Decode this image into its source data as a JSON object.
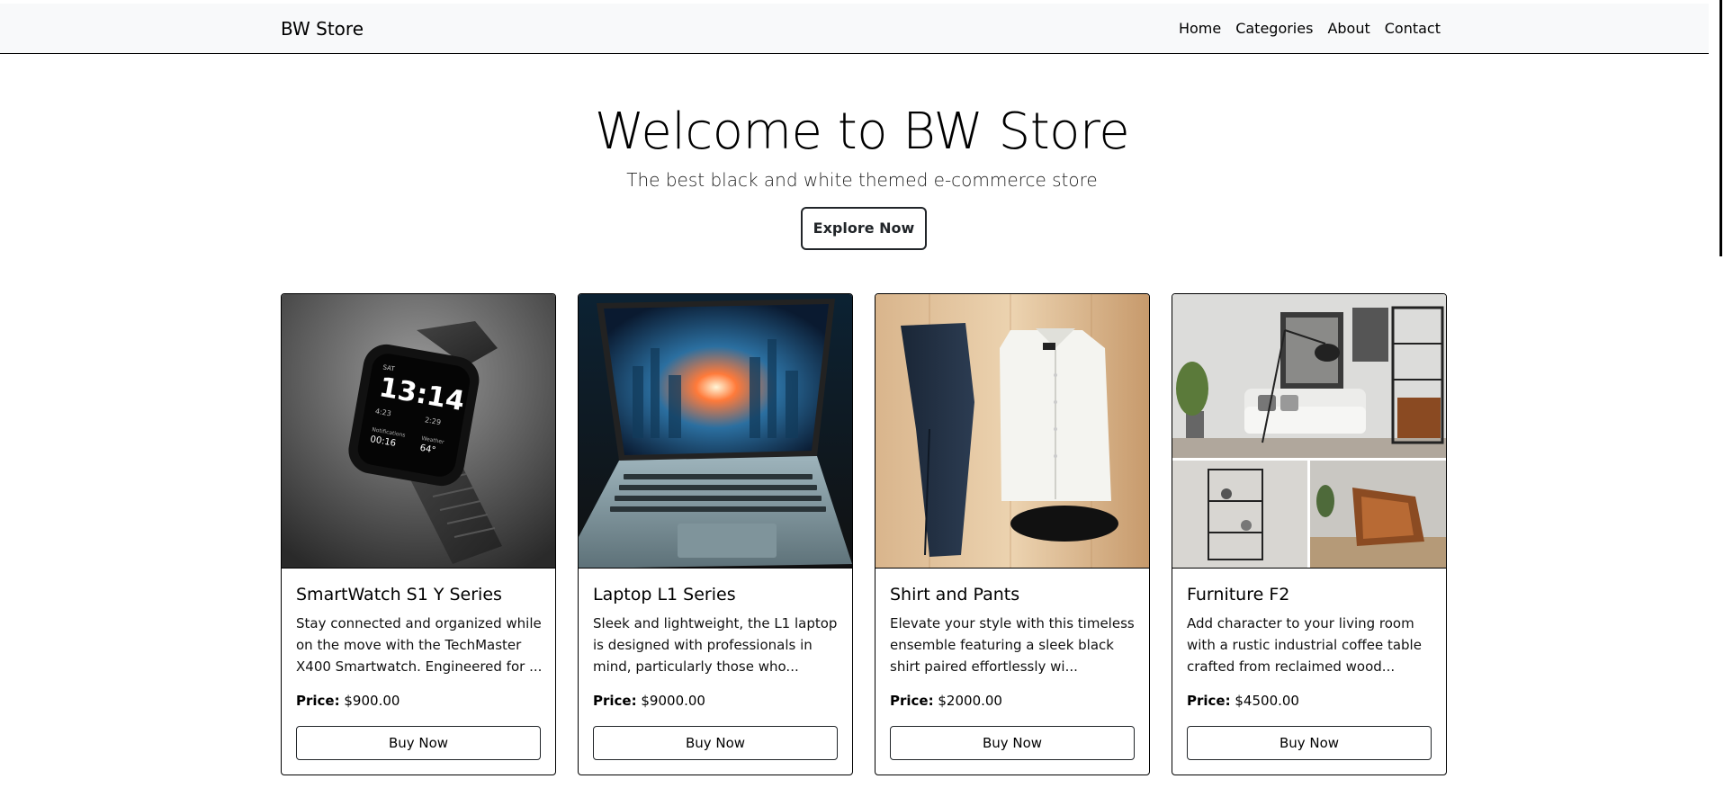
{
  "navbar": {
    "brand": "BW Store",
    "links": [
      "Home",
      "Categories",
      "About",
      "Contact"
    ]
  },
  "hero": {
    "title": "Welcome to BW Store",
    "subtitle": "The best black and white themed e-commerce store",
    "button_label": "Explore Now"
  },
  "products": [
    {
      "title": "SmartWatch S1 Y Series",
      "description": "Stay connected and organized while on the move with the TechMaster X400 Smartwatch. Engineered for ...",
      "price_label": "Price:",
      "price": "$900.00",
      "button_label": "Buy Now",
      "image": "smartwatch-image",
      "watch_time": "13:14"
    },
    {
      "title": "Laptop L1 Series",
      "description": "Sleek and lightweight, the L1 laptop is designed with professionals in mind, particularly those who...",
      "price_label": "Price:",
      "price": "$9000.00",
      "button_label": "Buy Now",
      "image": "laptop-image"
    },
    {
      "title": "Shirt and Pants",
      "description": "Elevate your style with this timeless ensemble featuring a sleek black shirt paired effortlessly wi...",
      "price_label": "Price:",
      "price": "$2000.00",
      "button_label": "Buy Now",
      "image": "shirt-pants-image"
    },
    {
      "title": "Furniture F2",
      "description": "Add character to your living room with a rustic industrial coffee table crafted from reclaimed wood...",
      "price_label": "Price:",
      "price": "$4500.00",
      "button_label": "Buy Now",
      "image": "furniture-image"
    }
  ],
  "colors": {
    "navbar_bg": "#f8f9fa",
    "border": "#000000",
    "button_border": "#212529"
  }
}
